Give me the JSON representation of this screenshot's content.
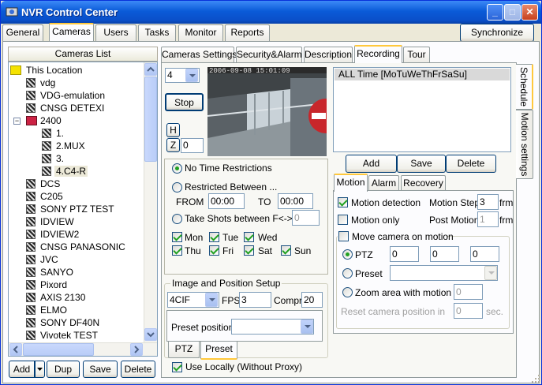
{
  "window": {
    "title": "NVR Control Center"
  },
  "main_tabs": [
    "General",
    "Cameras",
    "Users",
    "Tasks",
    "Monitor",
    "Reports"
  ],
  "synchronize_label": "Synchronize",
  "cameras_list": {
    "header": "Cameras List",
    "root": "This Location",
    "items": [
      "vdg",
      "VDG-emulation",
      "CNSG DETEXI",
      "2400",
      "1.",
      "2.MUX",
      "3.",
      "4.C4-R",
      "DCS",
      "C205",
      "SONY PTZ TEST",
      "IDVIEW",
      "IDVIEW2",
      "CNSG PANASONIC",
      "JVC",
      "SANYO",
      "Pixord",
      "AXIS 2130",
      "ELMO",
      "SONY DF40N",
      "Vivotek TEST"
    ],
    "buttons": {
      "add": "Add",
      "dup": "Dup",
      "save": "Save",
      "delete": "Delete"
    }
  },
  "camera_tabs": [
    "Cameras Settings",
    "Security&Alarm",
    "Description",
    "Recording",
    "Tour"
  ],
  "preview": {
    "camera_number": "4",
    "stop_label": "Stop",
    "timestamp": "2006-09-08 15:01:09",
    "h_label": "H",
    "z_label": "Z",
    "z_value": "0"
  },
  "time": {
    "no_restrictions": "No Time Restrictions",
    "restricted_between": "Restricted Between ...",
    "from_label": "FROM",
    "from_value": "00:00",
    "to_label": "TO",
    "to_value": "00:00",
    "take_shots": "Take Shots between F<->T",
    "take_shots_value": "0",
    "days": [
      "Mon",
      "Tue",
      "Wed",
      "Thu",
      "Fri",
      "Sat",
      "Sun"
    ]
  },
  "image_setup": {
    "title": "Image and Position Setup",
    "resolution": "4CIF",
    "fps_label": "FPS",
    "fps_value": "3",
    "compr_label": "Compr.",
    "compr_value": "20",
    "preset_position_label": "Preset position:",
    "preset_position_value": "",
    "subtabs": [
      "PTZ",
      "Preset"
    ]
  },
  "use_locally": "Use Locally (Without Proxy)",
  "schedule": {
    "items": [
      "ALL Time [MoTuWeThFrSaSu]"
    ],
    "add": "Add",
    "save": "Save",
    "delete": "Delete"
  },
  "side_tabs": [
    "Schedule",
    "Motion settings"
  ],
  "motion_tabs": [
    "Motion",
    "Alarm",
    "Recovery"
  ],
  "motion": {
    "detection_label": "Motion detection",
    "motion_step_label": "Motion Step",
    "motion_step_value": "3",
    "motion_step_unit": "frm",
    "motion_only_label": "Motion only",
    "post_motion_label": "Post Motion",
    "post_motion_value": "1",
    "post_motion_unit": "frm",
    "move_camera_label": "Move camera on motion",
    "ptz_label": "PTZ",
    "ptz_values": [
      "0",
      "0",
      "0"
    ],
    "preset_label": "Preset",
    "zoom_label": "Zoom area with motion",
    "zoom_value": "0",
    "reset_label": "Reset camera position in",
    "reset_value": "0",
    "reset_unit": "sec."
  }
}
